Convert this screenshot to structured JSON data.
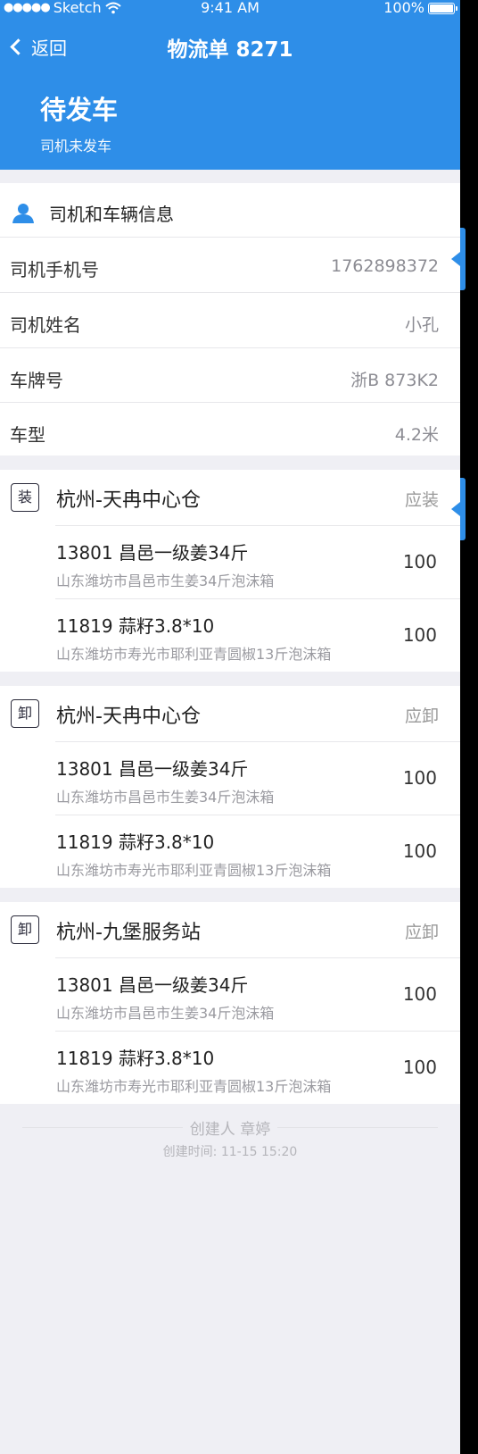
{
  "status_bar": {
    "carrier": "Sketch",
    "time": "9:41 AM",
    "battery": "100%"
  },
  "nav": {
    "back_label": "返回",
    "title": "物流单 8271"
  },
  "status": {
    "main": "待发车",
    "sub": "司机未发车"
  },
  "driver_info": {
    "title": "司机和车辆信息",
    "rows": [
      {
        "label": "司机手机号",
        "value": "1762898372"
      },
      {
        "label": "司机姓名",
        "value": "小孔"
      },
      {
        "label": "车牌号",
        "value": "浙B 873K2"
      },
      {
        "label": "车型",
        "value": "4.2米"
      }
    ]
  },
  "stops": [
    {
      "badge": "装",
      "name": "杭州-天冉中心仓",
      "type": "应装",
      "items": [
        {
          "title": "13801  昌邑一级姜34斤",
          "desc": "山东潍坊市昌邑市生姜34斤泡沫箱",
          "qty": "100"
        },
        {
          "title": "11819  蒜籽3.8*10",
          "desc": "山东潍坊市寿光市耶利亚青圆椒13斤泡沫箱",
          "qty": "100"
        }
      ]
    },
    {
      "badge": "卸",
      "name": "杭州-天冉中心仓",
      "type": "应卸",
      "items": [
        {
          "title": "13801  昌邑一级姜34斤",
          "desc": "山东潍坊市昌邑市生姜34斤泡沫箱",
          "qty": "100"
        },
        {
          "title": "11819  蒜籽3.8*10",
          "desc": "山东潍坊市寿光市耶利亚青圆椒13斤泡沫箱",
          "qty": "100"
        }
      ]
    },
    {
      "badge": "卸",
      "name": "杭州-九堡服务站",
      "type": "应卸",
      "items": [
        {
          "title": "13801  昌邑一级姜34斤",
          "desc": "山东潍坊市昌邑市生姜34斤泡沫箱",
          "qty": "100"
        },
        {
          "title": "11819  蒜籽3.8*10",
          "desc": "山东潍坊市寿光市耶利亚青圆椒13斤泡沫箱",
          "qty": "100"
        }
      ]
    }
  ],
  "footer": {
    "creator": "创建人 章婷",
    "created_time": "创建时间: 11-15 15:20"
  },
  "colors": {
    "primary": "#2e8ee8",
    "background": "#efeff4"
  },
  "icons": {
    "user": "user-icon",
    "back": "chevron-left-icon",
    "wifi": "wifi-icon"
  }
}
